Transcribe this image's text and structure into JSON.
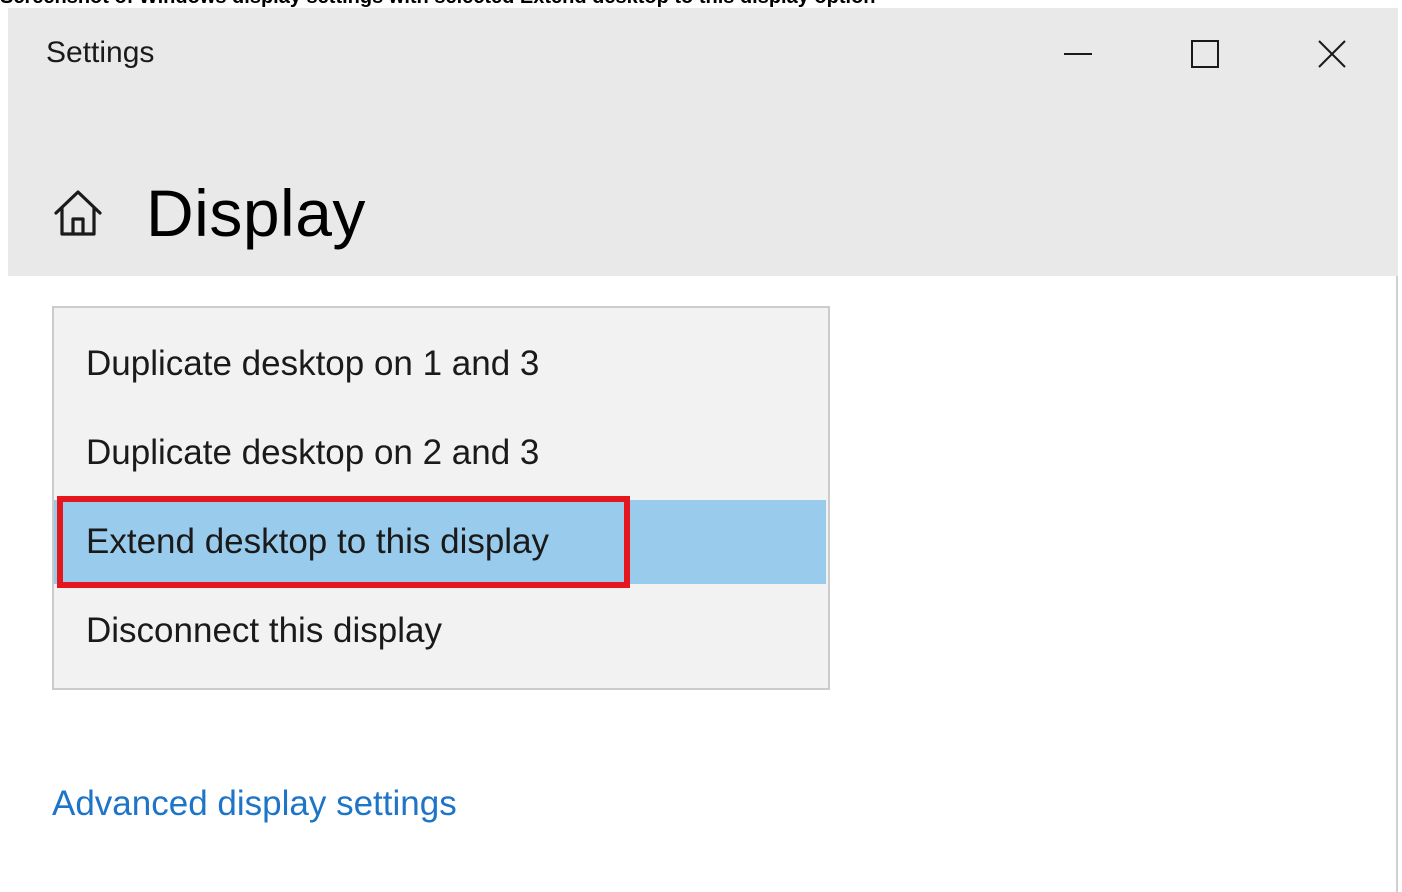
{
  "top_caption": "Screenshot of Windows display settings with selected Extend desktop to this display option",
  "window": {
    "title": "Settings",
    "controls": [
      "minimize-icon",
      "maximize-icon",
      "close-icon"
    ]
  },
  "page": {
    "icon": "home-icon",
    "title": "Display"
  },
  "dropdown": {
    "options": [
      {
        "label": "Duplicate desktop on 1 and 3",
        "selected": false
      },
      {
        "label": "Duplicate desktop on 2 and 3",
        "selected": false
      },
      {
        "label": "Extend desktop to this display",
        "selected": true
      },
      {
        "label": "Disconnect this display",
        "selected": false
      }
    ],
    "selected_label": "Extend desktop to this display"
  },
  "links": {
    "advanced": "Advanced display settings"
  },
  "colors": {
    "header_bg": "#e9e9e9",
    "dropdown_bg": "#f2f2f2",
    "selected_bg": "#99cbec",
    "annotation_border": "#e5161c",
    "link": "#1e74c6"
  }
}
